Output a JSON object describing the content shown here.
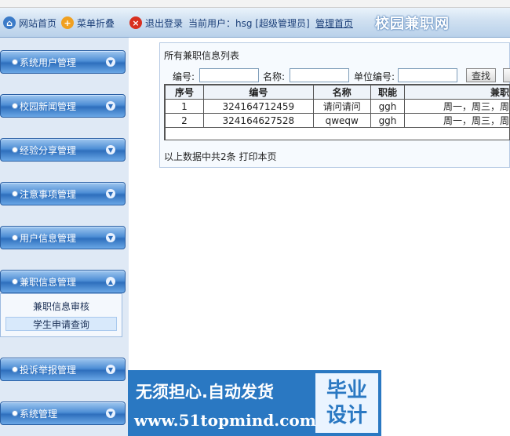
{
  "header": {
    "home": "网站首页",
    "fold": "菜单折叠",
    "exit": "退出登录",
    "current_user": "当前用户：hsg [超级管理员]",
    "admin_home": "管理首页",
    "site_title": "校园兼职网"
  },
  "sidebar": {
    "items": [
      "系统用户管理",
      "校园新闻管理",
      "经验分享管理",
      "注意事项管理",
      "用户信息管理",
      "兼职信息管理",
      "投诉举报管理",
      "系统管理"
    ],
    "submenu": [
      "兼职信息审核",
      "学生申请查询"
    ]
  },
  "panel": {
    "title": "所有兼职信息列表",
    "search": {
      "code_label": "编号:",
      "name_label": "名称:",
      "unit_label": "单位编号:",
      "button": "查找"
    },
    "columns": [
      "序号",
      "编号",
      "名称",
      "职能",
      "兼职"
    ],
    "rows": [
      [
        "1",
        "324164712459",
        "请问请问",
        "ggh",
        "周一，周三，周"
      ],
      [
        "2",
        "324164627528",
        "qweqw",
        "ggh",
        "周一，周三，周"
      ]
    ],
    "footer": "以上数据中共2条  打印本页"
  },
  "watermark": {
    "line1": "无须担心.自动发货",
    "line2": "www.51topmind.com",
    "box1": "毕业",
    "box2": "设计"
  }
}
